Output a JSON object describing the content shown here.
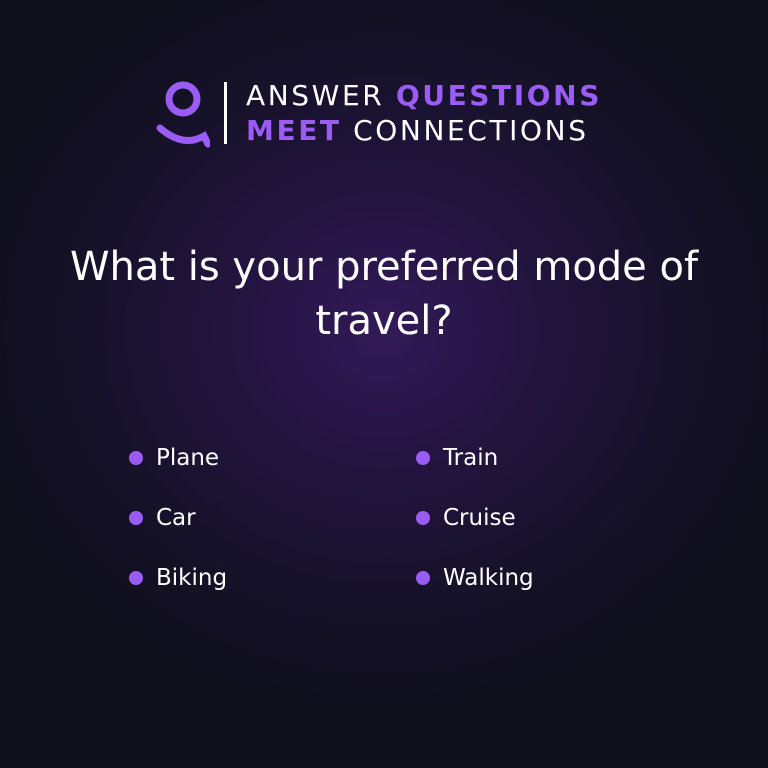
{
  "header": {
    "line1_part1": "ANSWER",
    "line1_part2": "QUESTIONS",
    "line2_part1": "MEET",
    "line2_part2": "CONNECTIONS",
    "logo_icon": "person-icon",
    "accent_color": "#9b5cf6"
  },
  "question": {
    "text": "What is your preferred mode of travel?"
  },
  "options": [
    {
      "label": "Plane"
    },
    {
      "label": "Train"
    },
    {
      "label": "Car"
    },
    {
      "label": "Cruise"
    },
    {
      "label": "Biking"
    },
    {
      "label": "Walking"
    }
  ]
}
